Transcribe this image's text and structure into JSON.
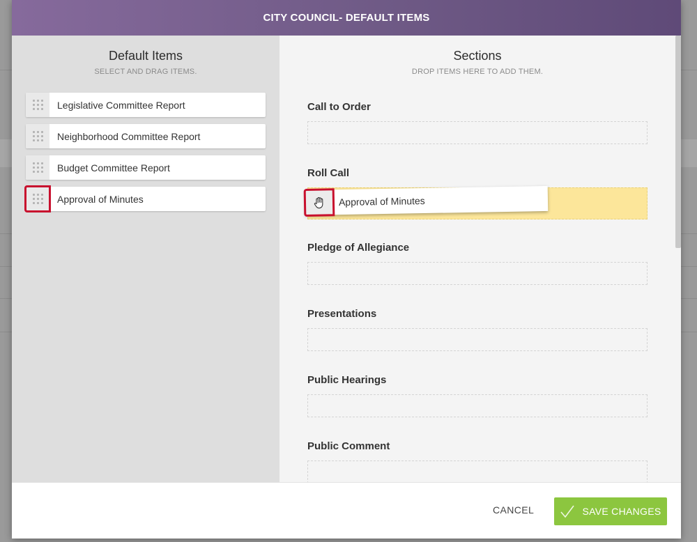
{
  "modal": {
    "title": "CITY COUNCIL- DEFAULT ITEMS"
  },
  "default_items": {
    "title": "Default Items",
    "subtitle": "SELECT AND DRAG ITEMS.",
    "items": [
      {
        "label": "Legislative Committee Report"
      },
      {
        "label": "Neighborhood Committee Report"
      },
      {
        "label": "Budget Committee Report"
      },
      {
        "label": "Approval of Minutes"
      }
    ]
  },
  "sections": {
    "title": "Sections",
    "subtitle": "DROP ITEMS HERE TO ADD THEM.",
    "list": [
      {
        "label": "Call to Order"
      },
      {
        "label": "Roll Call"
      },
      {
        "label": "Pledge of Allegiance"
      },
      {
        "label": "Presentations"
      },
      {
        "label": "Public Hearings"
      },
      {
        "label": "Public Comment"
      }
    ]
  },
  "drag": {
    "label": "Approval of Minutes",
    "icon": "grab-hand-icon"
  },
  "footer": {
    "cancel_label": "CANCEL",
    "save_label": "SAVE CHANGES"
  },
  "colors": {
    "header": "#6f5a86",
    "save": "#8cc63f",
    "drop_active": "#fce69a",
    "highlight": "#c8102e"
  }
}
